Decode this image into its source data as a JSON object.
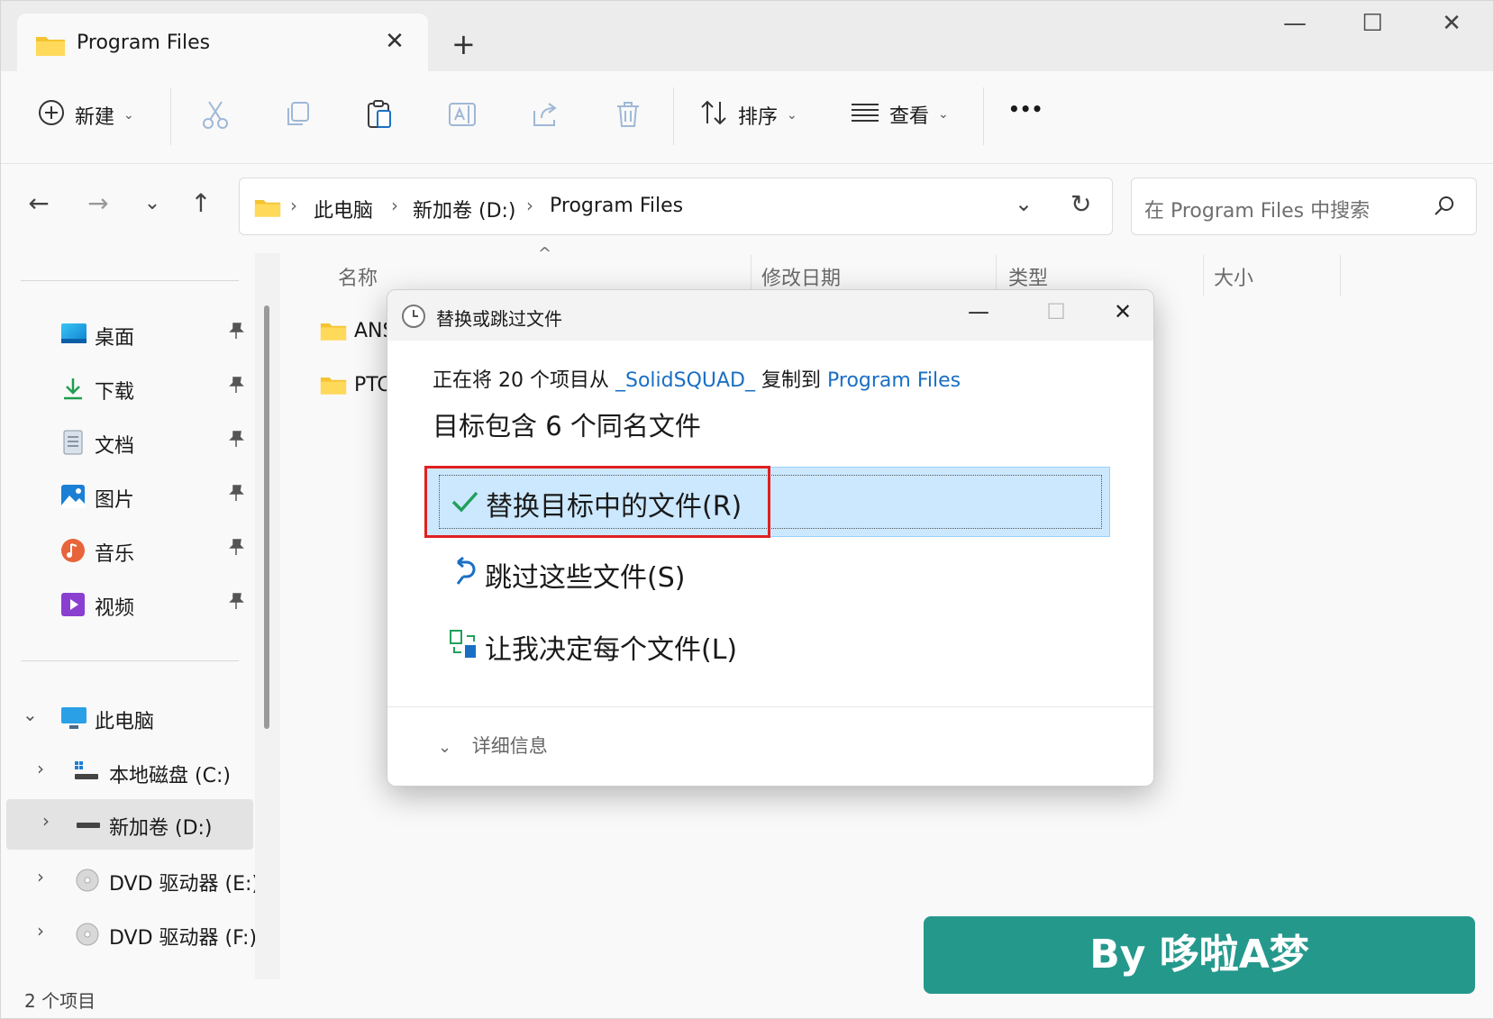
{
  "window": {
    "tab_title": "Program Files",
    "new_tab_symbol": "+",
    "tab_close_symbol": "✕",
    "minimize_symbol": "—",
    "maximize_symbol": "☐",
    "close_symbol": "✕"
  },
  "toolbar": {
    "new_label": "新建",
    "sort_label": "排序",
    "view_label": "查看",
    "more_symbol": "•••",
    "caret": "⌄"
  },
  "nav": {
    "back": "←",
    "forward": "→",
    "recent": "⌄",
    "up": "↑"
  },
  "address": {
    "crumbs": [
      "此电脑",
      "新加卷 (D:)",
      "Program Files"
    ],
    "sep": "›",
    "dropdown": "⌄",
    "refresh": "↻"
  },
  "search": {
    "placeholder": "在 Program Files 中搜索"
  },
  "sidebar": {
    "quick": [
      {
        "label": "桌面"
      },
      {
        "label": "下载"
      },
      {
        "label": "文档"
      },
      {
        "label": "图片"
      },
      {
        "label": "音乐"
      },
      {
        "label": "视频"
      }
    ],
    "pin_symbol": "📌",
    "this_pc": "此电脑",
    "drives": [
      {
        "label": "本地磁盘 (C:)"
      },
      {
        "label": "新加卷 (D:)"
      },
      {
        "label": "DVD 驱动器 (E:)"
      },
      {
        "label": "DVD 驱动器 (F:)"
      }
    ],
    "expand_symbol": "›",
    "collapse_symbol": "⌄"
  },
  "columns": {
    "name": "名称",
    "modified": "修改日期",
    "type": "类型",
    "size": "大小",
    "sort_indicator": "^"
  },
  "files": [
    {
      "name": "ANS"
    },
    {
      "name": "PTC"
    }
  ],
  "status": {
    "count": "2 个项目"
  },
  "dialog": {
    "title": "替换或跳过文件",
    "line_prefix": "正在将 20 个项目从",
    "source": "_SolidSQUAD_",
    "line_mid": "复制到",
    "destination": "Program Files",
    "heading": "目标包含 6 个同名文件",
    "options": [
      {
        "label": "替换目标中的文件(R)",
        "icon": "check-icon"
      },
      {
        "label": "跳过这些文件(S)",
        "icon": "undo-arrow-icon"
      },
      {
        "label": "让我决定每个文件(L)",
        "icon": "compare-files-icon"
      }
    ],
    "details": "详细信息",
    "details_chevron": "⌄"
  },
  "watermark": {
    "text": "By 哆啦A梦"
  },
  "colors": {
    "accent": "#1a6fc4",
    "selected_option": "#cce8ff",
    "highlight_box": "#e02020",
    "watermark": "#25988c",
    "folder": "#f4c431"
  }
}
